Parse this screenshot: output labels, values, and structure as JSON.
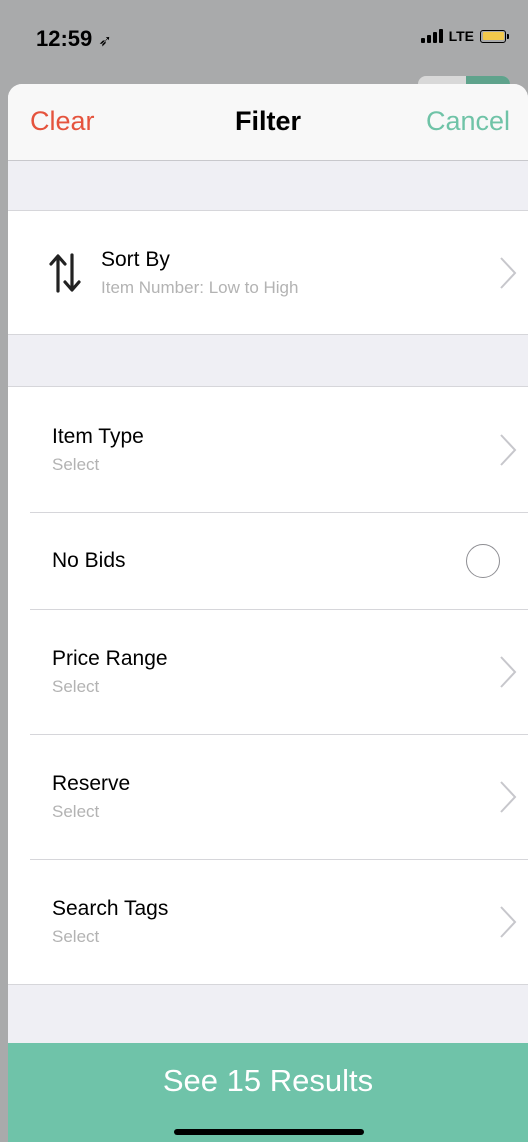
{
  "status_bar": {
    "time": "12:59",
    "network": "LTE"
  },
  "nav": {
    "left": "Clear",
    "title": "Filter",
    "right": "Cancel"
  },
  "sort": {
    "title": "Sort By",
    "value": "Item Number: Low to High"
  },
  "filters": [
    {
      "title": "Item Type",
      "value": "Select"
    },
    {
      "title": "No Bids"
    },
    {
      "title": "Price Range",
      "value": "Select"
    },
    {
      "title": "Reserve",
      "value": "Select"
    },
    {
      "title": "Search Tags",
      "value": "Select"
    }
  ],
  "results_button": "See 15 Results",
  "colors": {
    "clear": "#e5533d",
    "cancel": "#6fc3a7",
    "results_bar": "#6fc3a9"
  }
}
